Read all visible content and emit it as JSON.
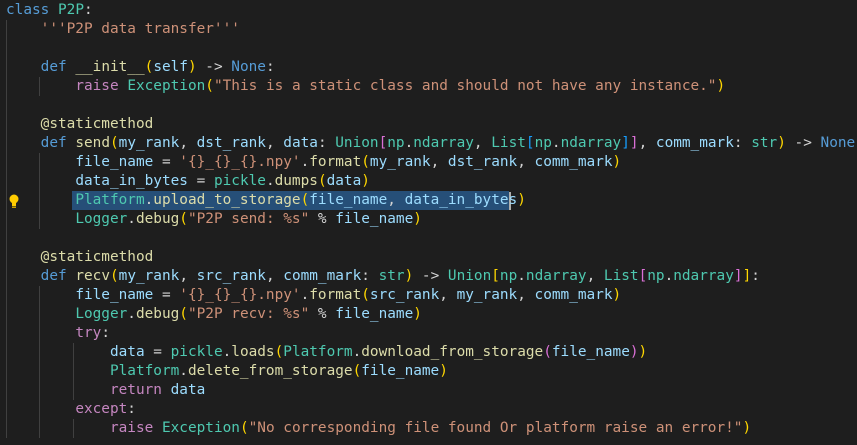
{
  "editor": {
    "language": "python",
    "lines": [
      {
        "indent": 0,
        "tokens": [
          [
            "kw",
            "class"
          ],
          [
            "p",
            " "
          ],
          [
            "cls",
            "P2P"
          ],
          [
            "p",
            ":"
          ]
        ]
      },
      {
        "indent": 1,
        "tokens": [
          [
            "str",
            "'''P2P data transfer'''"
          ]
        ]
      },
      {
        "indent": 0,
        "tokens": []
      },
      {
        "indent": 1,
        "tokens": [
          [
            "kw",
            "def"
          ],
          [
            "p",
            " "
          ],
          [
            "fn",
            "__init__"
          ],
          [
            "brk1",
            "("
          ],
          [
            "var",
            "self"
          ],
          [
            "brk1",
            ")"
          ],
          [
            "p",
            " -> "
          ],
          [
            "kw",
            "None"
          ],
          [
            "p",
            ":"
          ]
        ]
      },
      {
        "indent": 2,
        "tokens": [
          [
            "ctl",
            "raise"
          ],
          [
            "p",
            " "
          ],
          [
            "cls",
            "Exception"
          ],
          [
            "brk1",
            "("
          ],
          [
            "str",
            "\"This is a static class and should not have any instance.\""
          ],
          [
            "brk1",
            ")"
          ]
        ]
      },
      {
        "indent": 0,
        "tokens": []
      },
      {
        "indent": 1,
        "tokens": [
          [
            "dec",
            "@staticmethod"
          ]
        ]
      },
      {
        "indent": 1,
        "tokens": [
          [
            "kw",
            "def"
          ],
          [
            "p",
            " "
          ],
          [
            "fn",
            "send"
          ],
          [
            "brk1",
            "("
          ],
          [
            "var",
            "my_rank"
          ],
          [
            "p",
            ", "
          ],
          [
            "var",
            "dst_rank"
          ],
          [
            "p",
            ", "
          ],
          [
            "var",
            "data"
          ],
          [
            "p",
            ": "
          ],
          [
            "cls",
            "Union"
          ],
          [
            "brk2",
            "["
          ],
          [
            "cls",
            "np"
          ],
          [
            "p",
            "."
          ],
          [
            "cls",
            "ndarray"
          ],
          [
            "p",
            ", "
          ],
          [
            "cls",
            "List"
          ],
          [
            "brk3",
            "["
          ],
          [
            "cls",
            "np"
          ],
          [
            "p",
            "."
          ],
          [
            "cls",
            "ndarray"
          ],
          [
            "brk3",
            "]"
          ],
          [
            "brk2",
            "]"
          ],
          [
            "p",
            ", "
          ],
          [
            "var",
            "comm_mark"
          ],
          [
            "p",
            ": "
          ],
          [
            "cls",
            "str"
          ],
          [
            "brk1",
            ")"
          ],
          [
            "p",
            " -> "
          ],
          [
            "kw",
            "None"
          ],
          [
            "p",
            ":"
          ]
        ]
      },
      {
        "indent": 2,
        "tokens": [
          [
            "var",
            "file_name"
          ],
          [
            "p",
            " = "
          ],
          [
            "str",
            "'{}_{}_{}.npy'"
          ],
          [
            "p",
            "."
          ],
          [
            "fn",
            "format"
          ],
          [
            "brk1",
            "("
          ],
          [
            "var",
            "my_rank"
          ],
          [
            "p",
            ", "
          ],
          [
            "var",
            "dst_rank"
          ],
          [
            "p",
            ", "
          ],
          [
            "var",
            "comm_mark"
          ],
          [
            "brk1",
            ")"
          ]
        ]
      },
      {
        "indent": 2,
        "tokens": [
          [
            "var",
            "data_in_bytes"
          ],
          [
            "p",
            " = "
          ],
          [
            "cls",
            "pickle"
          ],
          [
            "p",
            "."
          ],
          [
            "fn",
            "dumps"
          ],
          [
            "brk1",
            "("
          ],
          [
            "var",
            "data"
          ],
          [
            "brk1",
            ")"
          ]
        ]
      },
      {
        "indent": 2,
        "tokens": [
          [
            "cls",
            "Platform"
          ],
          [
            "p",
            "."
          ],
          [
            "fn",
            "upload_to_storage"
          ],
          [
            "brk1",
            "("
          ],
          [
            "var",
            "file_name"
          ],
          [
            "p",
            ", "
          ],
          [
            "var",
            "data_in_bytes"
          ],
          [
            "brk1",
            ")"
          ]
        ]
      },
      {
        "indent": 2,
        "tokens": [
          [
            "cls",
            "Logger"
          ],
          [
            "p",
            "."
          ],
          [
            "fn",
            "debug"
          ],
          [
            "brk1",
            "("
          ],
          [
            "str",
            "\"P2P send: %s\""
          ],
          [
            "p",
            " % "
          ],
          [
            "var",
            "file_name"
          ],
          [
            "brk1",
            ")"
          ]
        ]
      },
      {
        "indent": 0,
        "tokens": []
      },
      {
        "indent": 1,
        "tokens": [
          [
            "dec",
            "@staticmethod"
          ]
        ]
      },
      {
        "indent": 1,
        "tokens": [
          [
            "kw",
            "def"
          ],
          [
            "p",
            " "
          ],
          [
            "fn",
            "recv"
          ],
          [
            "brk1",
            "("
          ],
          [
            "var",
            "my_rank"
          ],
          [
            "p",
            ", "
          ],
          [
            "var",
            "src_rank"
          ],
          [
            "p",
            ", "
          ],
          [
            "var",
            "comm_mark"
          ],
          [
            "p",
            ": "
          ],
          [
            "cls",
            "str"
          ],
          [
            "brk1",
            ")"
          ],
          [
            "p",
            " -> "
          ],
          [
            "cls",
            "Union"
          ],
          [
            "brk1",
            "["
          ],
          [
            "cls",
            "np"
          ],
          [
            "p",
            "."
          ],
          [
            "cls",
            "ndarray"
          ],
          [
            "p",
            ", "
          ],
          [
            "cls",
            "List"
          ],
          [
            "brk2",
            "["
          ],
          [
            "cls",
            "np"
          ],
          [
            "p",
            "."
          ],
          [
            "cls",
            "ndarray"
          ],
          [
            "brk2",
            "]"
          ],
          [
            "brk1",
            "]"
          ],
          [
            "p",
            ":"
          ]
        ]
      },
      {
        "indent": 2,
        "tokens": [
          [
            "var",
            "file_name"
          ],
          [
            "p",
            " = "
          ],
          [
            "str",
            "'{}_{}_{}.npy'"
          ],
          [
            "p",
            "."
          ],
          [
            "fn",
            "format"
          ],
          [
            "brk1",
            "("
          ],
          [
            "var",
            "src_rank"
          ],
          [
            "p",
            ", "
          ],
          [
            "var",
            "my_rank"
          ],
          [
            "p",
            ", "
          ],
          [
            "var",
            "comm_mark"
          ],
          [
            "brk1",
            ")"
          ]
        ]
      },
      {
        "indent": 2,
        "tokens": [
          [
            "cls",
            "Logger"
          ],
          [
            "p",
            "."
          ],
          [
            "fn",
            "debug"
          ],
          [
            "brk1",
            "("
          ],
          [
            "str",
            "\"P2P recv: %s\""
          ],
          [
            "p",
            " % "
          ],
          [
            "var",
            "file_name"
          ],
          [
            "brk1",
            ")"
          ]
        ]
      },
      {
        "indent": 2,
        "tokens": [
          [
            "ctl",
            "try"
          ],
          [
            "p",
            ":"
          ]
        ]
      },
      {
        "indent": 3,
        "tokens": [
          [
            "var",
            "data"
          ],
          [
            "p",
            " = "
          ],
          [
            "cls",
            "pickle"
          ],
          [
            "p",
            "."
          ],
          [
            "fn",
            "loads"
          ],
          [
            "brk1",
            "("
          ],
          [
            "cls",
            "Platform"
          ],
          [
            "p",
            "."
          ],
          [
            "fn",
            "download_from_storage"
          ],
          [
            "brk2",
            "("
          ],
          [
            "var",
            "file_name"
          ],
          [
            "brk2",
            ")"
          ],
          [
            "brk1",
            ")"
          ]
        ]
      },
      {
        "indent": 3,
        "tokens": [
          [
            "cls",
            "Platform"
          ],
          [
            "p",
            "."
          ],
          [
            "fn",
            "delete_from_storage"
          ],
          [
            "brk1",
            "("
          ],
          [
            "var",
            "file_name"
          ],
          [
            "brk1",
            ")"
          ]
        ]
      },
      {
        "indent": 3,
        "tokens": [
          [
            "ctl",
            "return"
          ],
          [
            "p",
            " "
          ],
          [
            "var",
            "data"
          ]
        ]
      },
      {
        "indent": 2,
        "tokens": [
          [
            "ctl",
            "except"
          ],
          [
            "p",
            ":"
          ]
        ]
      },
      {
        "indent": 3,
        "tokens": [
          [
            "ctl",
            "raise"
          ],
          [
            "p",
            " "
          ],
          [
            "cls",
            "Exception"
          ],
          [
            "brk1",
            "("
          ],
          [
            "str",
            "\"No corresponding file found Or platform raise an error!\""
          ],
          [
            "brk1",
            ")"
          ]
        ]
      }
    ],
    "selected_line": 11,
    "lightbulb_icon": "lightbulb-icon"
  }
}
